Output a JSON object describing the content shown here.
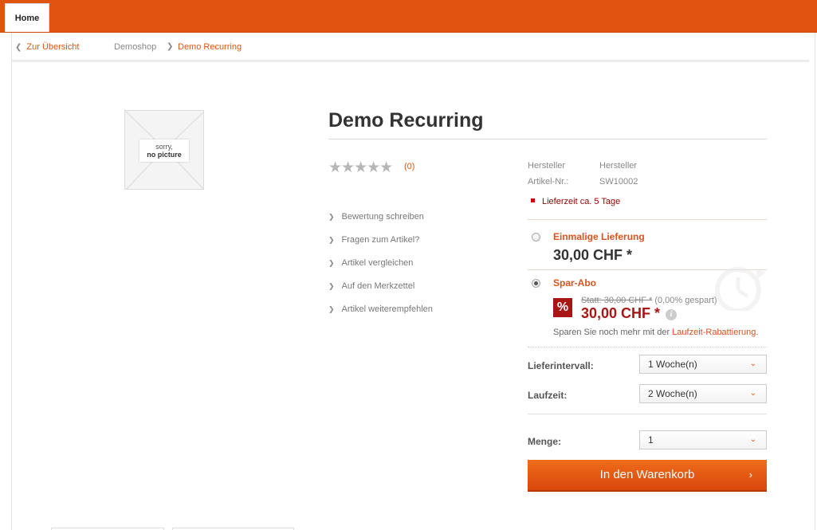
{
  "nav": {
    "home_label": "Home"
  },
  "breadcrumb": {
    "back_label": "Zur Übersicht",
    "back_chevron": "❮",
    "shop_label": "Demoshop",
    "separator": "❯",
    "current_label": "Demo Recurring"
  },
  "product": {
    "no_picture_line1": "sorry,",
    "no_picture_line2": "no picture",
    "title": "Demo Recurring",
    "stars": "★★★★★",
    "rating_count": "(0)"
  },
  "actions": [
    {
      "label": "Bewertung schreiben"
    },
    {
      "label": "Fragen zum Artikel?"
    },
    {
      "label": "Artikel vergleichen"
    },
    {
      "label": "Auf den Merkzettel"
    },
    {
      "label": "Artikel weiterempfehlen"
    }
  ],
  "action_arrow": "❯",
  "meta": {
    "manufacturer_label": "Hersteller",
    "manufacturer_value": "Hersteller",
    "article_label": "Artikel-Nr.:",
    "article_value": "SW10002",
    "delivery": "Lieferzeit ca. 5 Tage"
  },
  "options": {
    "once_label": "Einmalige Lieferung",
    "once_price": "30,00 CHF *",
    "abo_label": "Spar-Abo",
    "abo_badge": "%",
    "abo_old_price": "Statt: 30,00 CHF *",
    "abo_saved": "(0,00% gespart)",
    "abo_price": "30,00 CHF *",
    "info_glyph": "i",
    "save_text_prefix": "Sparen Sie noch mehr mit der ",
    "save_link": "Laufzeit-Rabattierung",
    "save_text_suffix": ".",
    "selected": "Spar-Abo"
  },
  "form": {
    "interval_label": "Lieferintervall:",
    "interval_value": "1  Woche(n)",
    "duration_label": "Laufzeit:",
    "duration_value": "2 Woche(n)",
    "quantity_label": "Menge:",
    "quantity_value": "1",
    "caret": "⌄"
  },
  "buy": {
    "label": "In den Warenkorb",
    "arrow": "›"
  },
  "colors": {
    "accent": "#e1540f",
    "price_red": "#a81515"
  }
}
